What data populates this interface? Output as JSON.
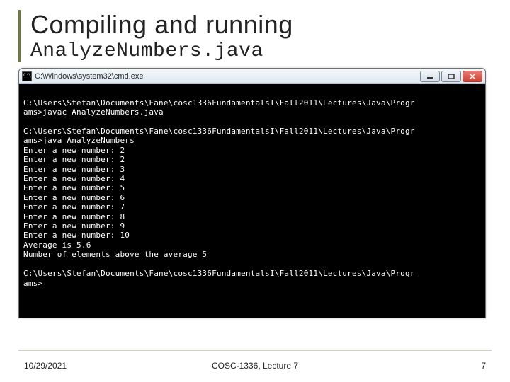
{
  "slide": {
    "title": "Compiling and running",
    "subtitle": "AnalyzeNumbers.java"
  },
  "window": {
    "titlebar": "C:\\Windows\\system32\\cmd.exe",
    "icon_name": "cmd-icon"
  },
  "console": {
    "lines": [
      "",
      "C:\\Users\\Stefan\\Documents\\Fane\\cosc1336FundamentalsI\\Fall2011\\Lectures\\Java\\Progr",
      "ams>javac AnalyzeNumbers.java",
      "",
      "C:\\Users\\Stefan\\Documents\\Fane\\cosc1336FundamentalsI\\Fall2011\\Lectures\\Java\\Progr",
      "ams>java AnalyzeNumbers",
      "Enter a new number: 2",
      "Enter a new number: 2",
      "Enter a new number: 3",
      "Enter a new number: 4",
      "Enter a new number: 5",
      "Enter a new number: 6",
      "Enter a new number: 7",
      "Enter a new number: 8",
      "Enter a new number: 9",
      "Enter a new number: 10",
      "Average is 5.6",
      "Number of elements above the average 5",
      "",
      "C:\\Users\\Stefan\\Documents\\Fane\\cosc1336FundamentalsI\\Fall2011\\Lectures\\Java\\Progr",
      "ams>"
    ]
  },
  "footer": {
    "date": "10/29/2021",
    "course": "COSC-1336, Lecture 7",
    "page": "7"
  }
}
